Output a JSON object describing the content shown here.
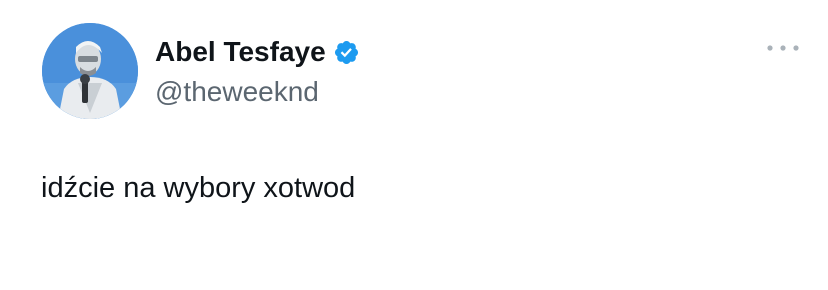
{
  "tweet": {
    "author": {
      "display_name": "Abel Tesfaye",
      "handle": "@theweeknd",
      "verified": true,
      "avatar_icon": "profile-photo"
    },
    "text": "idźcie na wybory xotwod",
    "more_icon": "more-horizontal-icon"
  },
  "colors": {
    "background": "#ffffff",
    "text_primary": "#0f1419",
    "text_secondary": "#5b6670",
    "verified_blue": "#1d9bf0",
    "more_dots": "#aab2b9"
  }
}
